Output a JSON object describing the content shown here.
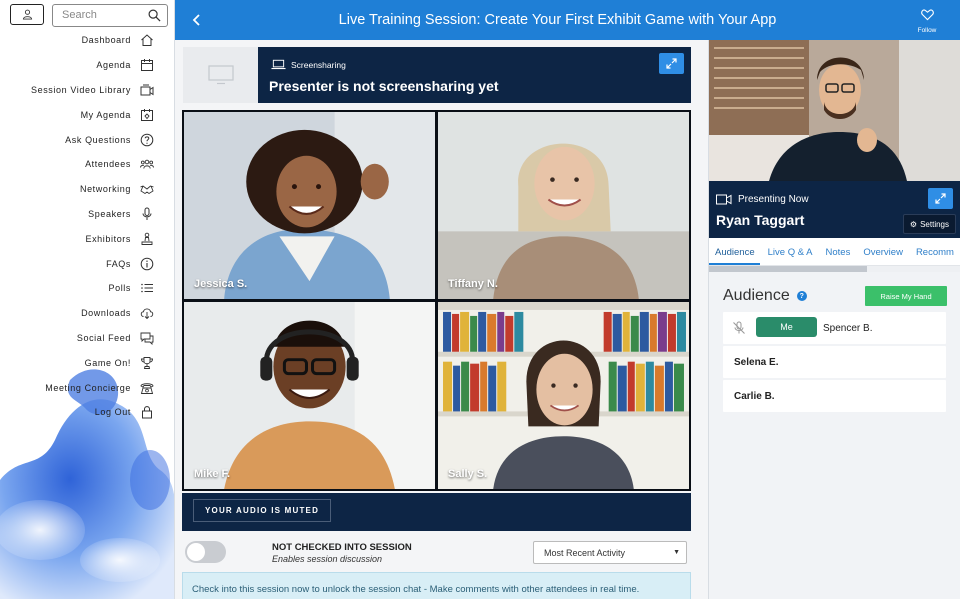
{
  "sidebar": {
    "search_placeholder": "Search",
    "items": [
      {
        "label": "Dashboard",
        "icon": "home-icon"
      },
      {
        "label": "Agenda",
        "icon": "calendar-icon"
      },
      {
        "label": "Session Video Library",
        "icon": "video-library-icon"
      },
      {
        "label": "My Agenda",
        "icon": "my-agenda-icon"
      },
      {
        "label": "Ask Questions",
        "icon": "question-icon"
      },
      {
        "label": "Attendees",
        "icon": "attendees-icon"
      },
      {
        "label": "Networking",
        "icon": "handshake-icon"
      },
      {
        "label": "Speakers",
        "icon": "microphone-icon"
      },
      {
        "label": "Exhibitors",
        "icon": "exhibitor-icon"
      },
      {
        "label": "FAQs",
        "icon": "info-icon"
      },
      {
        "label": "Polls",
        "icon": "list-icon"
      },
      {
        "label": "Downloads",
        "icon": "download-icon"
      },
      {
        "label": "Social Feed",
        "icon": "chat-icon"
      },
      {
        "label": "Game On!",
        "icon": "trophy-icon"
      },
      {
        "label": "Meeting Concierge",
        "icon": "phone-icon"
      },
      {
        "label": "Log Out",
        "icon": "lock-icon"
      }
    ]
  },
  "header": {
    "title": "Live Training Session: Create Your First Exhibit Game with Your App",
    "follow_label": "Follow"
  },
  "screenshare": {
    "tag": "Screensharing",
    "message": "Presenter is not screensharing yet"
  },
  "participants": [
    {
      "name": "Jessica S."
    },
    {
      "name": "Tiffany N."
    },
    {
      "name": "Mike F."
    },
    {
      "name": "Sally S."
    }
  ],
  "audio": {
    "muted_label": "YOUR AUDIO IS MUTED"
  },
  "checkin": {
    "status": "NOT CHECKED INTO SESSION",
    "subtitle": "Enables session discussion",
    "sort_selected": "Most Recent Activity",
    "banner": "Check into this session now to unlock the session chat - Make comments with other attendees in real time."
  },
  "presenter": {
    "label": "Presenting Now",
    "name": "Ryan Taggart",
    "settings_label": "Settings"
  },
  "tabs": [
    {
      "label": "Audience"
    },
    {
      "label": "Live Q & A"
    },
    {
      "label": "Notes"
    },
    {
      "label": "Overview"
    },
    {
      "label": "Recomm"
    }
  ],
  "audience": {
    "title": "Audience",
    "help": "?",
    "raise_hand_label": "Raise My Hand",
    "me_label": "Me",
    "me_name": "Spencer B.",
    "others": [
      {
        "name": "Selena E."
      },
      {
        "name": "Carlie B."
      }
    ]
  },
  "colors": {
    "brand_blue": "#1f7fd6",
    "navy": "#0d2545",
    "raise_green": "#3bc06a",
    "me_green": "#2a8c6a"
  }
}
